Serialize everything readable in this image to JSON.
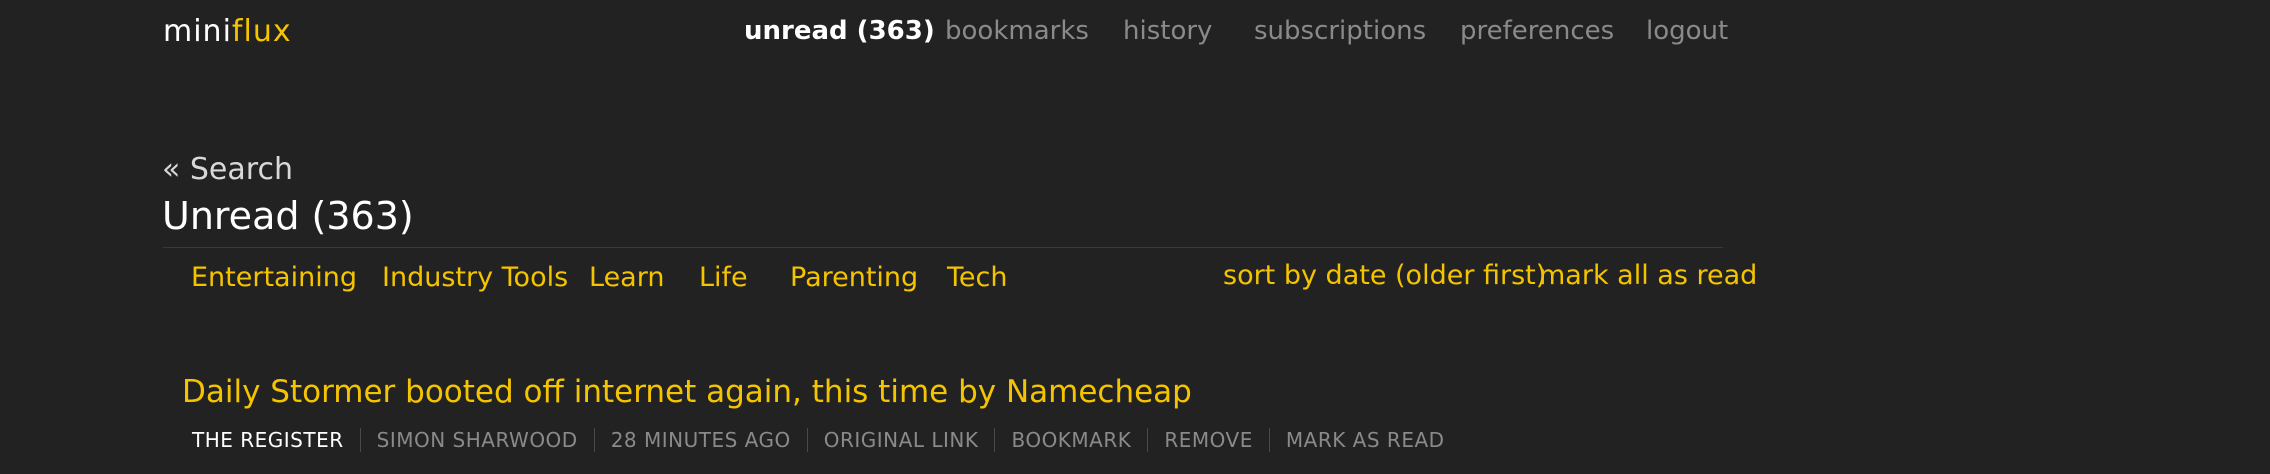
{
  "brand": {
    "part1": "mini",
    "part2": "flux",
    "accent": "#f5c400"
  },
  "nav": {
    "unread": "unread (363)",
    "bookmarks": "bookmarks",
    "history": "history",
    "subscriptions": "subscriptions",
    "preferences": "preferences",
    "logout": "logout"
  },
  "back_link": "« Search",
  "page_title": "Unread (363)",
  "groups": [
    "Entertaining",
    "Industry Tools",
    "Learn",
    "Life",
    "Parenting",
    "Tech"
  ],
  "actions": {
    "sort": "sort by date (older first)",
    "mark_all": "mark all as read"
  },
  "items": [
    {
      "title": "Daily Stormer booted off internet again, this time by Namecheap",
      "feed": "The Register",
      "author": "Simon Sharwood",
      "time": "28 minutes ago",
      "original_link": "original link",
      "bookmark": "bookmark",
      "remove": "remove",
      "mark_read": "mark as read"
    }
  ],
  "colors": {
    "background": "#222222",
    "accent": "#f5c400",
    "muted": "#8a8a8a",
    "text": "#ffffff"
  }
}
